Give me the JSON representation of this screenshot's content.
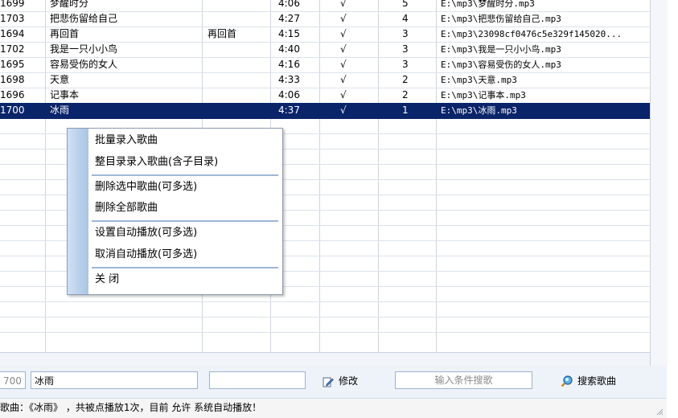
{
  "songs": [
    {
      "id": "1699",
      "title": "梦醒时分",
      "singer": "",
      "duration": "4:06",
      "auto": "√",
      "plays": "5",
      "path": "E:\\mp3\\梦醒时分.mp3"
    },
    {
      "id": "1703",
      "title": "把悲伤留给自己",
      "singer": "",
      "duration": "4:27",
      "auto": "√",
      "plays": "4",
      "path": "E:\\mp3\\把悲伤留给自己.mp3"
    },
    {
      "id": "1694",
      "title": "再回首",
      "singer": "再回首",
      "duration": "4:15",
      "auto": "√",
      "plays": "3",
      "path": "E:\\mp3\\23098cf0476c5e329f145020..."
    },
    {
      "id": "1702",
      "title": "我是一只小小鸟",
      "singer": "",
      "duration": "4:40",
      "auto": "√",
      "plays": "3",
      "path": "E:\\mp3\\我是一只小小鸟.mp3"
    },
    {
      "id": "1695",
      "title": "容易受伤的女人",
      "singer": "",
      "duration": "4:16",
      "auto": "√",
      "plays": "3",
      "path": "E:\\mp3\\容易受伤的女人.mp3"
    },
    {
      "id": "1698",
      "title": "天意",
      "singer": "",
      "duration": "4:33",
      "auto": "√",
      "plays": "2",
      "path": "E:\\mp3\\天意.mp3"
    },
    {
      "id": "1696",
      "title": "记事本",
      "singer": "",
      "duration": "4:06",
      "auto": "√",
      "plays": "2",
      "path": "E:\\mp3\\记事本.mp3"
    },
    {
      "id": "1700",
      "title": "冰雨",
      "singer": "",
      "duration": "4:37",
      "auto": "√",
      "plays": "1",
      "path": "E:\\mp3\\冰雨.mp3"
    }
  ],
  "context_menu": {
    "items": [
      "批量录入歌曲",
      "整目录录入歌曲(含子目录)",
      "删除选中歌曲(可多选)",
      "删除全部歌曲",
      "设置自动播放(可多选)",
      "取消自动播放(可多选)",
      "关 闭"
    ]
  },
  "editor": {
    "id_value": "700",
    "title_value": "冰雨",
    "singer_value": "",
    "modify_label": "修改",
    "search_placeholder": "输入条件搜歌",
    "search_button_label": "搜索歌曲"
  },
  "status_text": "歌曲：《冰雨》  ，共被点播放1次，目前 允许 系统自动播放！",
  "colors": {
    "selection": "#0a246a",
    "menu_strip": "#a9c4e4"
  }
}
